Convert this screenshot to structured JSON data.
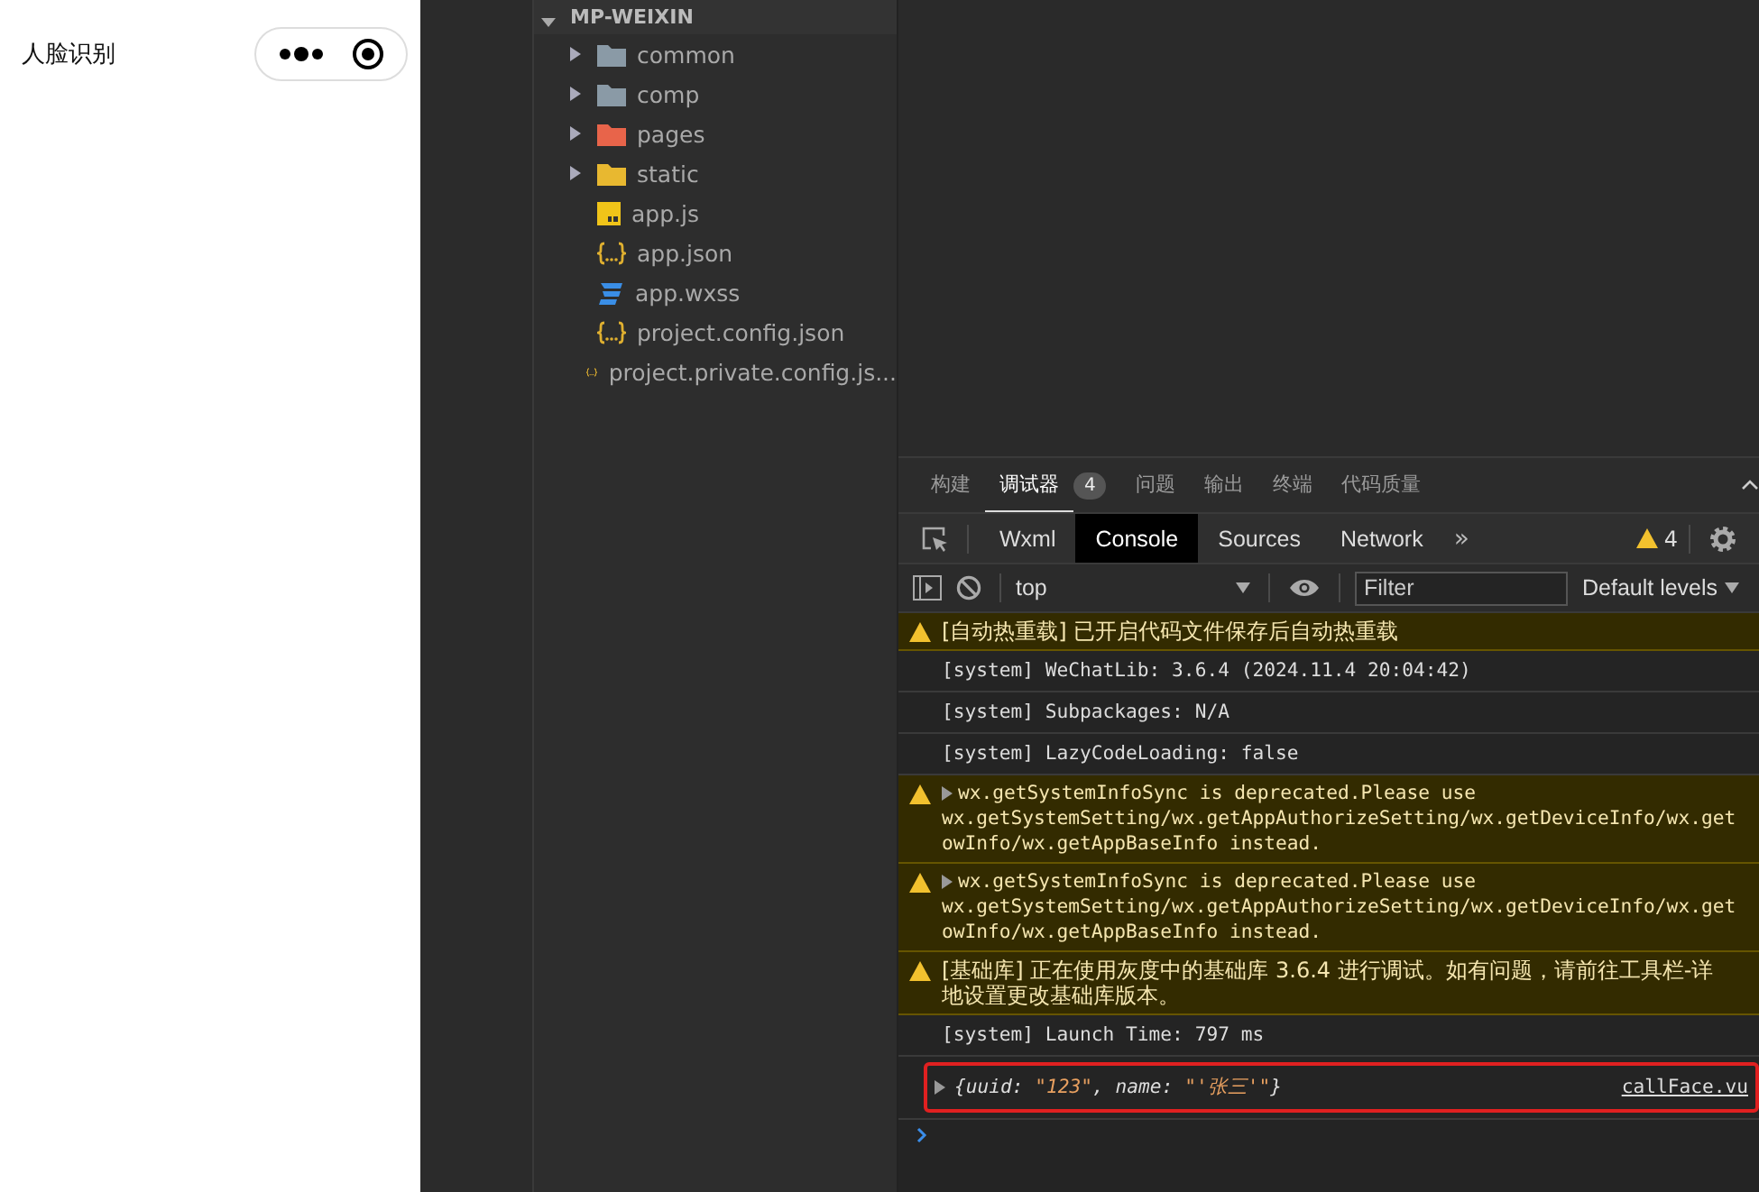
{
  "preview": {
    "title": "人脸识别"
  },
  "explorer": {
    "root": "MP-WEIXIN",
    "expanded": true,
    "items": [
      {
        "name": "common",
        "kind": "folder",
        "expanded": false
      },
      {
        "name": "comp",
        "kind": "folder",
        "expanded": false
      },
      {
        "name": "pages",
        "kind": "pagesfolder",
        "expanded": false
      },
      {
        "name": "static",
        "kind": "assetfolder",
        "expanded": false
      },
      {
        "name": "app.js",
        "kind": "js"
      },
      {
        "name": "app.json",
        "kind": "json"
      },
      {
        "name": "app.wxss",
        "kind": "css"
      },
      {
        "name": "project.config.json",
        "kind": "json"
      },
      {
        "name": "project.private.config.js...",
        "kind": "json"
      }
    ]
  },
  "devtools": {
    "tabs": [
      {
        "label": "构建",
        "selected": false
      },
      {
        "label": "调试器",
        "selected": true,
        "badge": "4"
      },
      {
        "label": "问题",
        "selected": false
      },
      {
        "label": "输出",
        "selected": false
      },
      {
        "label": "终端",
        "selected": false
      },
      {
        "label": "代码质量",
        "selected": false
      }
    ],
    "subtabs": [
      {
        "label": "Wxml",
        "selected": false
      },
      {
        "label": "Console",
        "selected": true
      },
      {
        "label": "Sources",
        "selected": false
      },
      {
        "label": "Network",
        "selected": false
      }
    ],
    "more": "»",
    "warning_count": "4",
    "context": "top",
    "filter": {
      "placeholder": "Filter"
    },
    "levels": "Default levels",
    "messages": [
      {
        "kind": "warning",
        "expandable": false,
        "cjk": true,
        "lines": [
          "[自动热重载] 已开启代码文件保存后自动热重载"
        ]
      },
      {
        "kind": "info",
        "expandable": false,
        "lines": [
          "[system] WeChatLib: 3.6.4 (2024.11.4 20:04:42)"
        ]
      },
      {
        "kind": "info",
        "expandable": false,
        "lines": [
          "[system] Subpackages: N/A"
        ]
      },
      {
        "kind": "info",
        "expandable": false,
        "lines": [
          "[system] LazyCodeLoading: false"
        ]
      },
      {
        "kind": "warning",
        "expandable": true,
        "lines": [
          "wx.getSystemInfoSync is deprecated.Please use",
          "wx.getSystemSetting/wx.getAppAuthorizeSetting/wx.getDeviceInfo/wx.get",
          "owInfo/wx.getAppBaseInfo instead."
        ]
      },
      {
        "kind": "warning",
        "expandable": true,
        "lines": [
          "wx.getSystemInfoSync is deprecated.Please use",
          "wx.getSystemSetting/wx.getAppAuthorizeSetting/wx.getDeviceInfo/wx.get",
          "owInfo/wx.getAppBaseInfo instead."
        ]
      },
      {
        "kind": "warning",
        "expandable": false,
        "cjk": true,
        "lines": [
          "[基础库] 正在使用灰度中的基础库 3.6.4 进行调试。如有问题，请前往工具栏-详",
          "地设置更改基础库版本。"
        ]
      },
      {
        "kind": "info",
        "expandable": false,
        "lines": [
          "[system] Launch Time: 797 ms"
        ]
      }
    ],
    "result": {
      "highlighted": true,
      "parts": [
        {
          "kind": "plain",
          "text": "{uuid: "
        },
        {
          "kind": "string",
          "text": "\"123\""
        },
        {
          "kind": "plain",
          "text": ", name: "
        },
        {
          "kind": "string",
          "text": "\"'张三'\""
        },
        {
          "kind": "plain",
          "text": "}"
        }
      ],
      "source": "callFace.vu"
    }
  }
}
